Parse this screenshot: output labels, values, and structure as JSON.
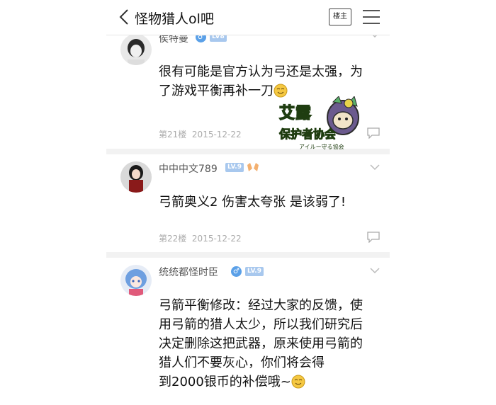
{
  "nav": {
    "title": "怪物猎人ol吧",
    "owner_label": "楼主"
  },
  "posts": [
    {
      "username": "侯特曼",
      "level": "LV8",
      "lines": [
        "很有可能是官方认为弓还是太强，为",
        "了游戏平衡再补一刀"
      ],
      "floor": "第21楼",
      "date": "2015-12-22"
    },
    {
      "username": "中中中文789",
      "level": "LV.9",
      "lines": [
        "弓箭奥义2 伤害太夸张 是该弱了!"
      ],
      "floor": "第22楼",
      "date": "2015-12-22"
    },
    {
      "username": "统统都怪时臣",
      "level": "LV.9",
      "lines": [
        "弓箭平衡修改：经过大家的反馈，使",
        "用弓箭的猎人太少，所以我们研究后",
        "决定删除这把武器，原来使用弓箭的",
        "猎人们不要灰心，你们将会得",
        "到2000银币的补偿哦~"
      ]
    }
  ],
  "sticker": {
    "text_top": "艾露",
    "text_main": "保护者协会",
    "text_sub": "アイルー守る協会"
  },
  "colors": {
    "accent_blue": "#5aa0e8",
    "level_badge": "#a8c8ee",
    "meta_gray": "#aaaaaa"
  }
}
